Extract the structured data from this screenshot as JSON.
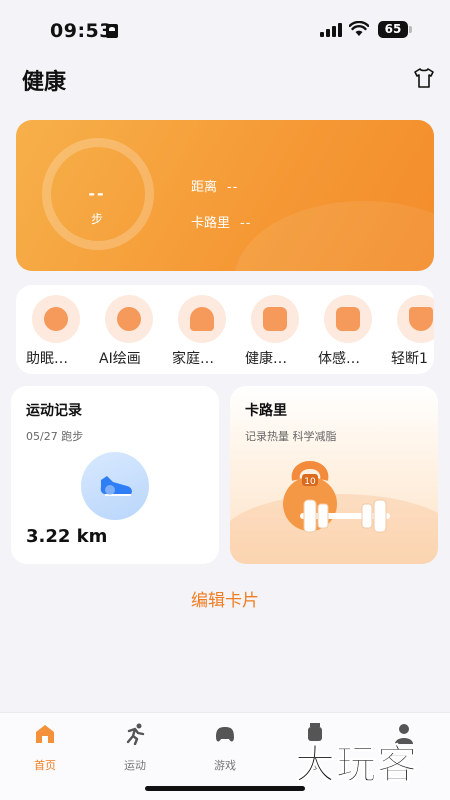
{
  "status_bar": {
    "time": "09:53",
    "battery": "65"
  },
  "header": {
    "title": "健康",
    "theme_icon": "shirt-icon"
  },
  "hero": {
    "steps_value": "--",
    "steps_label": "步",
    "distance_label": "距离",
    "distance_value": "--",
    "calorie_label": "卡路里",
    "calorie_value": "--"
  },
  "features": [
    {
      "label": "助眠…",
      "icon": "sleep-icon"
    },
    {
      "label": "AI绘画",
      "icon": "palette-icon"
    },
    {
      "label": "家庭…",
      "icon": "home-health-icon"
    },
    {
      "label": "健康…",
      "icon": "health-report-icon"
    },
    {
      "label": "体感…",
      "icon": "motion-game-icon"
    },
    {
      "label": "轻断1",
      "icon": "fasting-icon"
    }
  ],
  "exercise_card": {
    "title": "运动记录",
    "subtitle": "05/27 跑步",
    "distance": "3.22 km"
  },
  "calorie_card": {
    "title": "卡路里",
    "subtitle": "记录热量 科学减脂",
    "kettlebell_number": "10"
  },
  "edit_cards_label": "编辑卡片",
  "tabbar": [
    {
      "label": "首页",
      "icon": "home-icon",
      "active": true
    },
    {
      "label": "运动",
      "icon": "running-icon",
      "active": false
    },
    {
      "label": "游戏",
      "icon": "gamepad-icon",
      "active": false
    },
    {
      "label": "设",
      "icon": "watch-icon",
      "active": false
    },
    {
      "label": "",
      "icon": "profile-icon",
      "active": false
    }
  ],
  "watermark": "大玩客",
  "colors": {
    "accent": "#f07d22",
    "hero_start": "#f7b04a",
    "hero_end": "#f38c2a",
    "background": "#f4f3f7"
  }
}
